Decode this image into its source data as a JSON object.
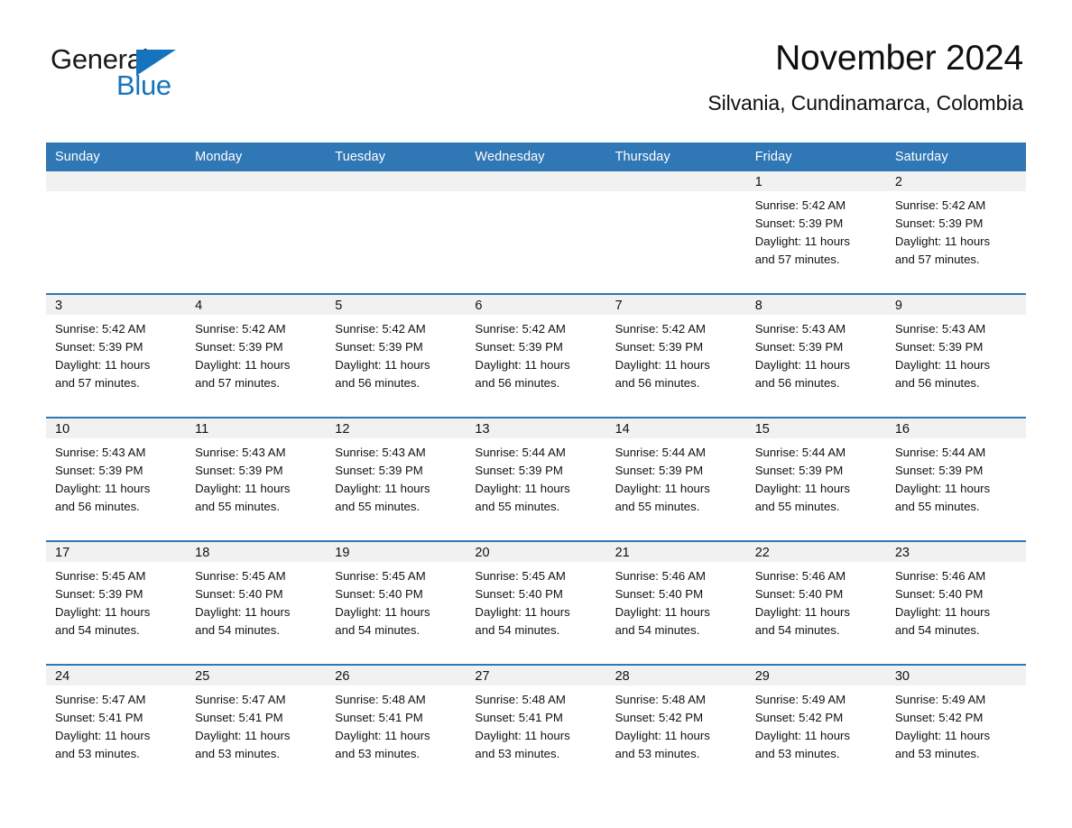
{
  "brand": {
    "name_part1": "General",
    "name_part2": "Blue",
    "accent_color": "#1574bd",
    "triangle_icon": "triangle-icon"
  },
  "header": {
    "title": "November 2024",
    "subtitle": "Silvania, Cundinamarca, Colombia"
  },
  "theme": {
    "header_bg": "#3077b5",
    "daynum_bg": "#f1f1f1",
    "rule_color": "#3077b5"
  },
  "weekday_headers": [
    "Sunday",
    "Monday",
    "Tuesday",
    "Wednesday",
    "Thursday",
    "Friday",
    "Saturday"
  ],
  "weeks": [
    [
      {
        "day": "",
        "sunrise": "",
        "sunset": "",
        "daylight1": "",
        "daylight2": ""
      },
      {
        "day": "",
        "sunrise": "",
        "sunset": "",
        "daylight1": "",
        "daylight2": ""
      },
      {
        "day": "",
        "sunrise": "",
        "sunset": "",
        "daylight1": "",
        "daylight2": ""
      },
      {
        "day": "",
        "sunrise": "",
        "sunset": "",
        "daylight1": "",
        "daylight2": ""
      },
      {
        "day": "",
        "sunrise": "",
        "sunset": "",
        "daylight1": "",
        "daylight2": ""
      },
      {
        "day": "1",
        "sunrise": "Sunrise: 5:42 AM",
        "sunset": "Sunset: 5:39 PM",
        "daylight1": "Daylight: 11 hours",
        "daylight2": "and 57 minutes."
      },
      {
        "day": "2",
        "sunrise": "Sunrise: 5:42 AM",
        "sunset": "Sunset: 5:39 PM",
        "daylight1": "Daylight: 11 hours",
        "daylight2": "and 57 minutes."
      }
    ],
    [
      {
        "day": "3",
        "sunrise": "Sunrise: 5:42 AM",
        "sunset": "Sunset: 5:39 PM",
        "daylight1": "Daylight: 11 hours",
        "daylight2": "and 57 minutes."
      },
      {
        "day": "4",
        "sunrise": "Sunrise: 5:42 AM",
        "sunset": "Sunset: 5:39 PM",
        "daylight1": "Daylight: 11 hours",
        "daylight2": "and 57 minutes."
      },
      {
        "day": "5",
        "sunrise": "Sunrise: 5:42 AM",
        "sunset": "Sunset: 5:39 PM",
        "daylight1": "Daylight: 11 hours",
        "daylight2": "and 56 minutes."
      },
      {
        "day": "6",
        "sunrise": "Sunrise: 5:42 AM",
        "sunset": "Sunset: 5:39 PM",
        "daylight1": "Daylight: 11 hours",
        "daylight2": "and 56 minutes."
      },
      {
        "day": "7",
        "sunrise": "Sunrise: 5:42 AM",
        "sunset": "Sunset: 5:39 PM",
        "daylight1": "Daylight: 11 hours",
        "daylight2": "and 56 minutes."
      },
      {
        "day": "8",
        "sunrise": "Sunrise: 5:43 AM",
        "sunset": "Sunset: 5:39 PM",
        "daylight1": "Daylight: 11 hours",
        "daylight2": "and 56 minutes."
      },
      {
        "day": "9",
        "sunrise": "Sunrise: 5:43 AM",
        "sunset": "Sunset: 5:39 PM",
        "daylight1": "Daylight: 11 hours",
        "daylight2": "and 56 minutes."
      }
    ],
    [
      {
        "day": "10",
        "sunrise": "Sunrise: 5:43 AM",
        "sunset": "Sunset: 5:39 PM",
        "daylight1": "Daylight: 11 hours",
        "daylight2": "and 56 minutes."
      },
      {
        "day": "11",
        "sunrise": "Sunrise: 5:43 AM",
        "sunset": "Sunset: 5:39 PM",
        "daylight1": "Daylight: 11 hours",
        "daylight2": "and 55 minutes."
      },
      {
        "day": "12",
        "sunrise": "Sunrise: 5:43 AM",
        "sunset": "Sunset: 5:39 PM",
        "daylight1": "Daylight: 11 hours",
        "daylight2": "and 55 minutes."
      },
      {
        "day": "13",
        "sunrise": "Sunrise: 5:44 AM",
        "sunset": "Sunset: 5:39 PM",
        "daylight1": "Daylight: 11 hours",
        "daylight2": "and 55 minutes."
      },
      {
        "day": "14",
        "sunrise": "Sunrise: 5:44 AM",
        "sunset": "Sunset: 5:39 PM",
        "daylight1": "Daylight: 11 hours",
        "daylight2": "and 55 minutes."
      },
      {
        "day": "15",
        "sunrise": "Sunrise: 5:44 AM",
        "sunset": "Sunset: 5:39 PM",
        "daylight1": "Daylight: 11 hours",
        "daylight2": "and 55 minutes."
      },
      {
        "day": "16",
        "sunrise": "Sunrise: 5:44 AM",
        "sunset": "Sunset: 5:39 PM",
        "daylight1": "Daylight: 11 hours",
        "daylight2": "and 55 minutes."
      }
    ],
    [
      {
        "day": "17",
        "sunrise": "Sunrise: 5:45 AM",
        "sunset": "Sunset: 5:39 PM",
        "daylight1": "Daylight: 11 hours",
        "daylight2": "and 54 minutes."
      },
      {
        "day": "18",
        "sunrise": "Sunrise: 5:45 AM",
        "sunset": "Sunset: 5:40 PM",
        "daylight1": "Daylight: 11 hours",
        "daylight2": "and 54 minutes."
      },
      {
        "day": "19",
        "sunrise": "Sunrise: 5:45 AM",
        "sunset": "Sunset: 5:40 PM",
        "daylight1": "Daylight: 11 hours",
        "daylight2": "and 54 minutes."
      },
      {
        "day": "20",
        "sunrise": "Sunrise: 5:45 AM",
        "sunset": "Sunset: 5:40 PM",
        "daylight1": "Daylight: 11 hours",
        "daylight2": "and 54 minutes."
      },
      {
        "day": "21",
        "sunrise": "Sunrise: 5:46 AM",
        "sunset": "Sunset: 5:40 PM",
        "daylight1": "Daylight: 11 hours",
        "daylight2": "and 54 minutes."
      },
      {
        "day": "22",
        "sunrise": "Sunrise: 5:46 AM",
        "sunset": "Sunset: 5:40 PM",
        "daylight1": "Daylight: 11 hours",
        "daylight2": "and 54 minutes."
      },
      {
        "day": "23",
        "sunrise": "Sunrise: 5:46 AM",
        "sunset": "Sunset: 5:40 PM",
        "daylight1": "Daylight: 11 hours",
        "daylight2": "and 54 minutes."
      }
    ],
    [
      {
        "day": "24",
        "sunrise": "Sunrise: 5:47 AM",
        "sunset": "Sunset: 5:41 PM",
        "daylight1": "Daylight: 11 hours",
        "daylight2": "and 53 minutes."
      },
      {
        "day": "25",
        "sunrise": "Sunrise: 5:47 AM",
        "sunset": "Sunset: 5:41 PM",
        "daylight1": "Daylight: 11 hours",
        "daylight2": "and 53 minutes."
      },
      {
        "day": "26",
        "sunrise": "Sunrise: 5:48 AM",
        "sunset": "Sunset: 5:41 PM",
        "daylight1": "Daylight: 11 hours",
        "daylight2": "and 53 minutes."
      },
      {
        "day": "27",
        "sunrise": "Sunrise: 5:48 AM",
        "sunset": "Sunset: 5:41 PM",
        "daylight1": "Daylight: 11 hours",
        "daylight2": "and 53 minutes."
      },
      {
        "day": "28",
        "sunrise": "Sunrise: 5:48 AM",
        "sunset": "Sunset: 5:42 PM",
        "daylight1": "Daylight: 11 hours",
        "daylight2": "and 53 minutes."
      },
      {
        "day": "29",
        "sunrise": "Sunrise: 5:49 AM",
        "sunset": "Sunset: 5:42 PM",
        "daylight1": "Daylight: 11 hours",
        "daylight2": "and 53 minutes."
      },
      {
        "day": "30",
        "sunrise": "Sunrise: 5:49 AM",
        "sunset": "Sunset: 5:42 PM",
        "daylight1": "Daylight: 11 hours",
        "daylight2": "and 53 minutes."
      }
    ]
  ]
}
